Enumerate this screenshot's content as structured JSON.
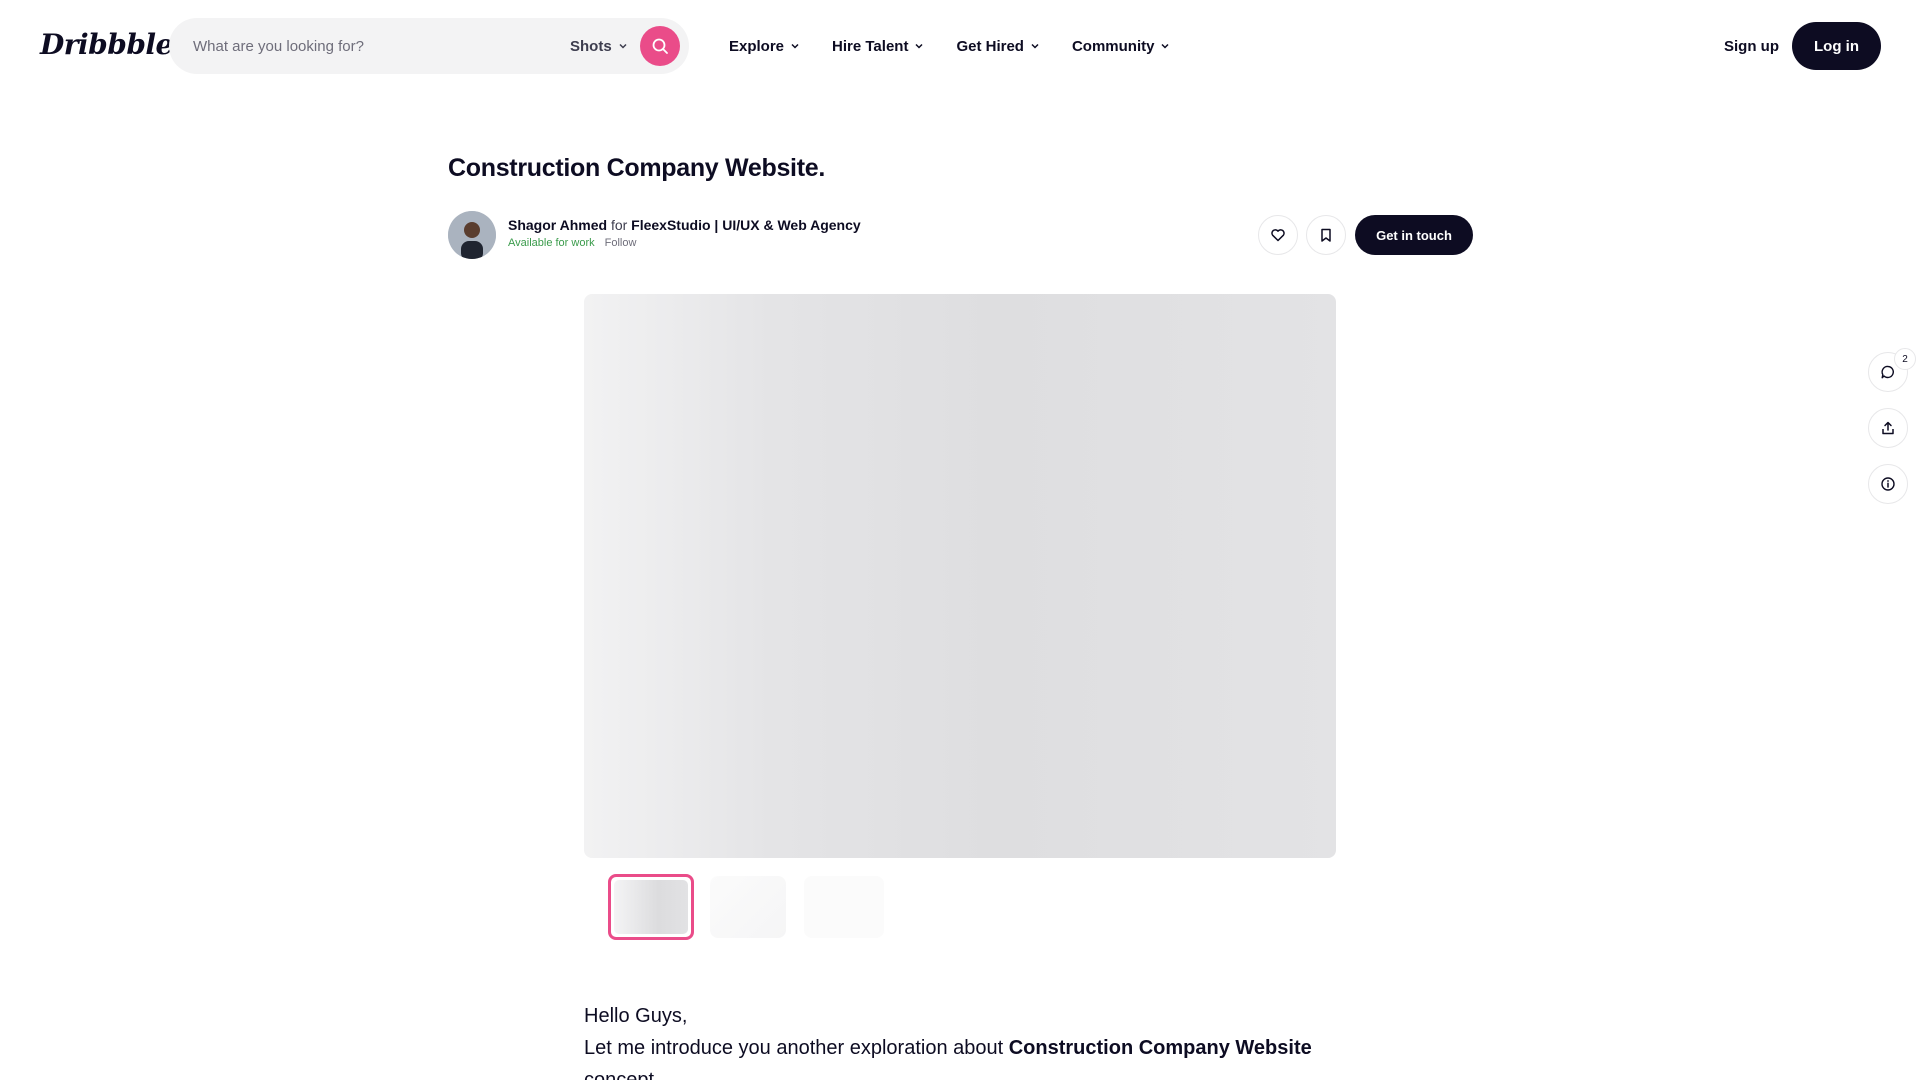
{
  "header": {
    "logo": "Dribbble",
    "search": {
      "placeholder": "What are you looking for?",
      "filter_label": "Shots"
    },
    "nav": [
      {
        "label": "Explore"
      },
      {
        "label": "Hire Talent"
      },
      {
        "label": "Get Hired"
      },
      {
        "label": "Community"
      }
    ],
    "signup_label": "Sign up",
    "login_label": "Log in"
  },
  "shot": {
    "title": "Construction Company Website.",
    "author": "Shagor Ahmed",
    "for_word": "for",
    "team": "FleexStudio | UI/UX & Web Agency",
    "availability": "Available for work",
    "follow_label": "Follow",
    "get_in_touch_label": "Get in touch"
  },
  "side_actions": {
    "comment_count": "2"
  },
  "description": {
    "greeting": "Hello Guys,",
    "intro": "Let me introduce you another exploration about ",
    "intro_bold": "Construction Company Website",
    "intro_end": "concept."
  },
  "colors": {
    "brand_pink": "#ea4c89",
    "dark": "#0d0c22",
    "available_green": "#3a9b4b"
  }
}
